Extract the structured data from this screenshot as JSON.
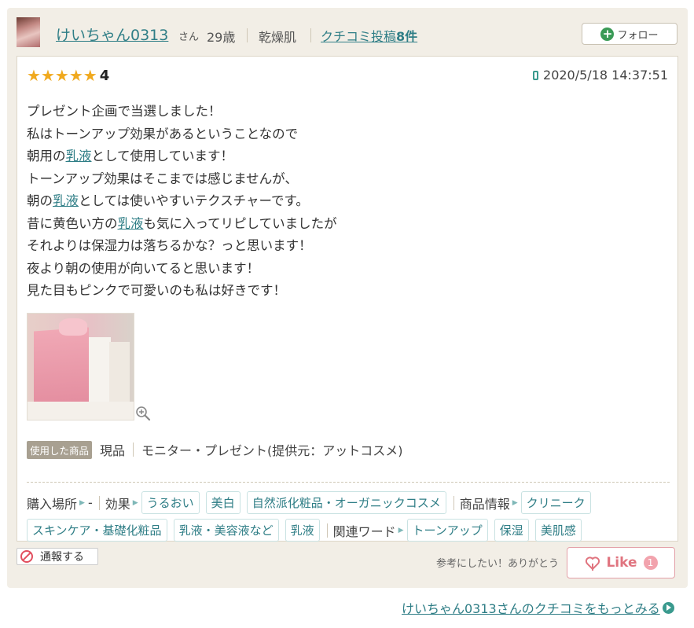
{
  "user": {
    "name": "けいちゃん0313",
    "honorific": "さん",
    "age": "29歳",
    "skin_type": "乾燥肌",
    "posts_prefix": "クチコミ投稿",
    "posts_count": "8件"
  },
  "follow_label": "フォロー",
  "review": {
    "rating": "4",
    "stars_filled": 5,
    "datetime": "2020/5/18 14:37:51",
    "lines": [
      [
        "プレゼント企画で当選しました！"
      ],
      [
        "私はトーンアップ効果があるということなので"
      ],
      [
        "朝用の",
        {
          "kw": "乳液"
        },
        "として使用しています！"
      ],
      [
        "トーンアップ効果はそこまでは感じませんが、"
      ],
      [
        "朝の",
        {
          "kw": "乳液"
        },
        "としては使いやすいテクスチャーです。"
      ],
      [
        "昔に黄色い方の",
        {
          "kw": "乳液"
        },
        "も気に入ってリピしていましたが"
      ],
      [
        "それよりは保湿力は落ちるかな？っと思います！"
      ],
      [
        "夜より朝の使用が向いてると思います！"
      ],
      [
        "見た目もピンクで可愛いのも私は好きです！"
      ]
    ]
  },
  "usage": {
    "tag": "使用した商品",
    "product_state": "現品",
    "source": "モニター・プレゼント(提供元：アットコスメ)"
  },
  "tags": {
    "purchase_label": "購入場所",
    "purchase_value": "-",
    "effect_label": "効果",
    "effect_chips": [
      "うるおい",
      "美白",
      "自然派化粧品・オーガニックコスメ"
    ],
    "product_label": "商品情報",
    "product_chips_row1": [
      "クリニーク"
    ],
    "product_chips_row2": [
      "スキンケア・基礎化粧品",
      "乳液・美容液など",
      "乳液"
    ],
    "related_label": "関連ワード",
    "related_chips": [
      "トーンアップ",
      "保湿",
      "美肌感"
    ]
  },
  "footer": {
    "report_label": "通報する",
    "thanks_text": "参考にしたい！ありがとう",
    "like_label": "Like",
    "like_count": "1"
  },
  "more_link": "けいちゃん0313さんのクチコミをもっとみる",
  "colors": {
    "link": "#2f7e86",
    "star": "#f0a91e",
    "card_bg": "#f2eee6",
    "like": "#e0747f"
  }
}
